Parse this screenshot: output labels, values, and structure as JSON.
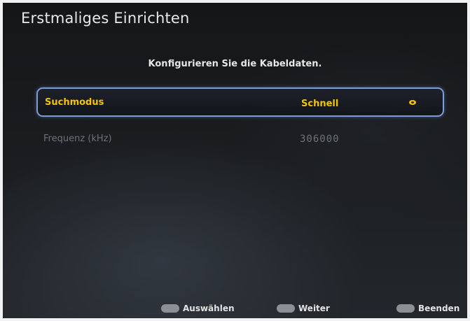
{
  "header": {
    "title": "Erstmaliges Einrichten"
  },
  "main": {
    "instruction": "Konfigurieren Sie die Kabeldaten.",
    "settings": [
      {
        "label": "Suchmodus",
        "value": "Schnell",
        "selected": true,
        "icon": "cycle-options-icon"
      },
      {
        "label": "Frequenz (kHz)",
        "value": "306000",
        "selected": false
      }
    ]
  },
  "footer": {
    "hints": [
      {
        "key_icon": "select-button-icon",
        "label": "Auswählen"
      },
      {
        "key_icon": "enter-button-icon",
        "label": "Weiter"
      },
      {
        "key_icon": "exit-button-icon",
        "label": "Beenden"
      }
    ]
  },
  "colors": {
    "highlight_text": "#f2c400",
    "selection_border": "#7d9bd4",
    "disabled_text": "#6e7278"
  }
}
